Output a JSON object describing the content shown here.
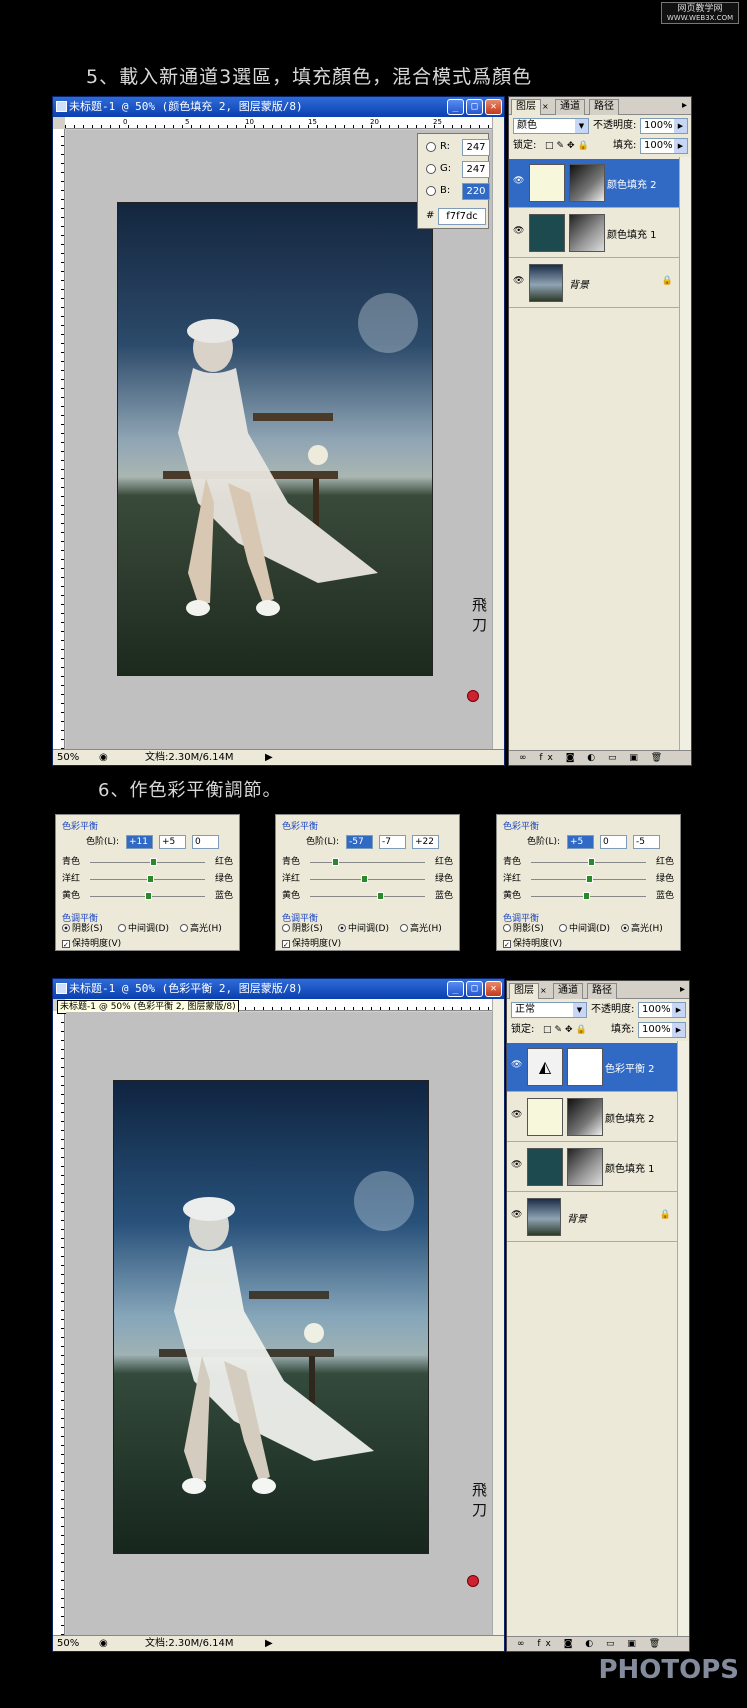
{
  "watermark_top": {
    "line1": "网页教学网",
    "line2": "WWW.WEB3X.COM"
  },
  "step5": {
    "heading": "5、載入新通道3選區，填充顏色，混合模式爲顏色"
  },
  "step6": {
    "heading": "6、作色彩平衡調節。"
  },
  "doc1": {
    "title": "未标题-1 @ 50% (颜色填充 2, 图层蒙版/8)",
    "zoom": "50%",
    "file_info": "文档:2.30M/6.14M",
    "ruler_labels": [
      "0",
      "5",
      "10",
      "15",
      "20",
      "25"
    ],
    "color_info": {
      "r_label": "R:",
      "r": "247",
      "g_label": "G:",
      "g": "247",
      "b_label": "B:",
      "b": "220",
      "hex_label": "#",
      "hex": "f7f7dc"
    }
  },
  "doc2": {
    "title": "未标题-1 @ 50% (色彩平衡 2, 图层蒙版/8)",
    "tooltip": "未标题-1 @ 50% (色彩平衡 2, 图层蒙版/8)",
    "zoom": "50%",
    "file_info": "文档:2.30M/6.14M",
    "ruler_labels": [
      "0",
      "5",
      "10",
      "15",
      "20",
      "25"
    ]
  },
  "layers1": {
    "tabs": [
      "图层",
      "通道",
      "路径"
    ],
    "blend_mode": "颜色",
    "opacity_label": "不透明度:",
    "opacity": "100%",
    "lock_label": "锁定:",
    "fill_label": "填充:",
    "fill": "100%",
    "items": [
      {
        "name": "颜色填充 2",
        "thumb_color": "#f7f7dc"
      },
      {
        "name": "颜色填充 1",
        "thumb_color": "#1d4a4e"
      },
      {
        "name": "背景",
        "thumb_color": "#4a5a70"
      }
    ]
  },
  "layers2": {
    "tabs": [
      "图层",
      "通道",
      "路径"
    ],
    "blend_mode": "正常",
    "opacity_label": "不透明度:",
    "opacity": "100%",
    "lock_label": "锁定:",
    "fill_label": "填充:",
    "fill": "100%",
    "items": [
      {
        "name": "色彩平衡 2",
        "thumb_color": "#ffffff"
      },
      {
        "name": "颜色填充 2",
        "thumb_color": "#f7f7dc"
      },
      {
        "name": "颜色填充 1",
        "thumb_color": "#1d4a4e"
      },
      {
        "name": "背景",
        "thumb_color": "#4a5a70"
      }
    ]
  },
  "color_balance_common": {
    "title": "色彩平衡",
    "levels_label": "色阶(L):",
    "rows": [
      {
        "left": "青色",
        "right": "红色"
      },
      {
        "left": "洋红",
        "right": "绿色"
      },
      {
        "left": "黄色",
        "right": "蓝色"
      }
    ],
    "tone_title": "色调平衡",
    "shadows": "阴影(S)",
    "midtones": "中间调(D)",
    "highlights": "高光(H)",
    "preserve": "保持明度(V)"
  },
  "color_balance": [
    {
      "levels": [
        "+11",
        "+5",
        "0"
      ],
      "tone": "shadows",
      "knobs": [
        0.55,
        0.52,
        0.5
      ]
    },
    {
      "levels": [
        "-57",
        "-7",
        "+22"
      ],
      "tone": "midtones",
      "knobs": [
        0.22,
        0.47,
        0.61
      ]
    },
    {
      "levels": [
        "+5",
        "0",
        "-5"
      ],
      "tone": "highlights",
      "knobs": [
        0.52,
        0.5,
        0.48
      ]
    }
  ],
  "bottom_logo": "PHOTOPS"
}
